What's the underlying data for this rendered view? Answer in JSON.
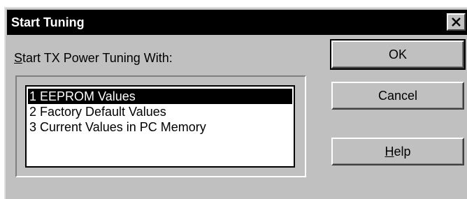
{
  "window": {
    "title": "Start Tuning",
    "close_icon": "close-icon"
  },
  "prompt": {
    "mnemonic": "S",
    "rest": "tart TX Power Tuning With:"
  },
  "list": {
    "items": [
      "1 EEPROM Values",
      "2 Factory Default Values",
      "3 Current Values in PC Memory"
    ],
    "selected_index": 0
  },
  "buttons": {
    "ok_label": "OK",
    "cancel_label": "Cancel",
    "help_mnemonic": "H",
    "help_rest": "elp"
  }
}
